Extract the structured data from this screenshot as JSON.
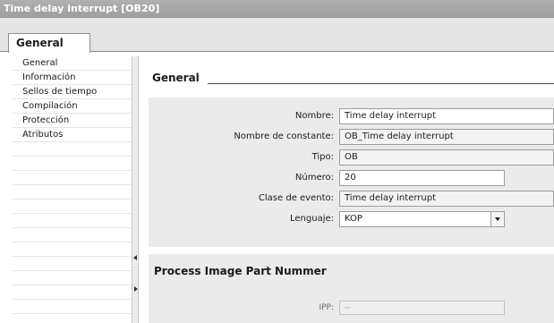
{
  "window": {
    "title": "Time delay interrupt [OB20]"
  },
  "tabs": [
    {
      "label": "General"
    }
  ],
  "sidebar": {
    "items": [
      {
        "label": "General"
      },
      {
        "label": "Información"
      },
      {
        "label": "Sellos de tiempo"
      },
      {
        "label": "Compilación"
      },
      {
        "label": "Protección"
      },
      {
        "label": "Atributos"
      }
    ]
  },
  "general_section": {
    "title": "General",
    "fields": {
      "nombre": {
        "label": "Nombre:",
        "value": "Time delay interrupt"
      },
      "constante": {
        "label": "Nombre de constante:",
        "value": "OB_Time delay interrupt"
      },
      "tipo": {
        "label": "Tipo:",
        "value": "OB"
      },
      "numero": {
        "label": "Número:",
        "value": "20"
      },
      "clase": {
        "label": "Clase de evento:",
        "value": "Time delay interrupt"
      },
      "lenguaje": {
        "label": "Lenguaje:",
        "value": "KOP"
      }
    }
  },
  "process_section": {
    "title": "Process Image Part Nummer",
    "ipp": {
      "label": "IPP:",
      "value": "--"
    }
  }
}
